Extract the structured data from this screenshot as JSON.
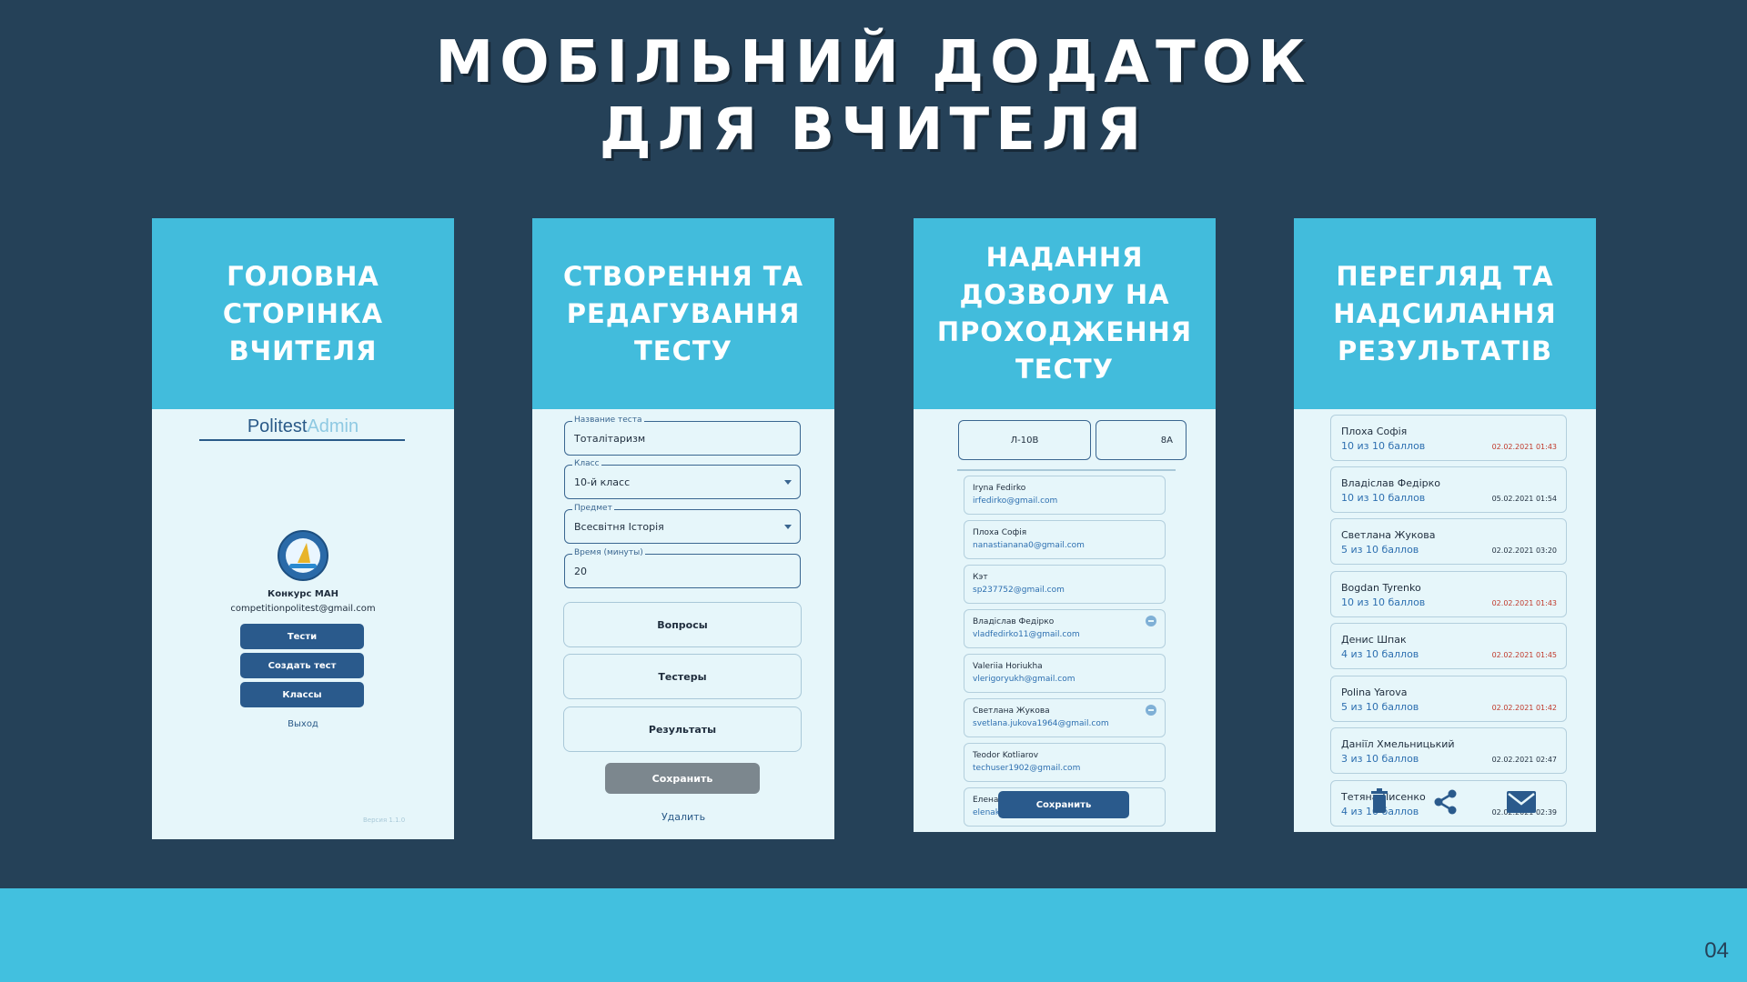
{
  "title": {
    "line1": "МОБІЛЬНИЙ ДОДАТОК",
    "line2": "ДЛЯ ВЧИТЕЛЯ"
  },
  "page_number": "04",
  "colors": {
    "background": "#254158",
    "accent": "#42bcdc",
    "button": "#2a5a8c",
    "screen": "#e6f6fa"
  },
  "cards": {
    "home": {
      "heading": [
        "ГОЛОВНА",
        "СТОРІНКА",
        "ВЧИТЕЛЯ"
      ],
      "logo_main": "Politest",
      "logo_admin": "Admin",
      "contest_name": "Конкурс МАН",
      "email": "competitionpolitest@gmail.com",
      "buttons": [
        "Тести",
        "Создать тест",
        "Классы"
      ],
      "exit": "Выход",
      "version": "Версия 1.1.0"
    },
    "edit": {
      "heading": [
        "СТВОРЕННЯ ТА",
        "РЕДАГУВАННЯ",
        "ТЕСТУ"
      ],
      "fields": [
        {
          "label": "Название теста",
          "value": "Тоталітаризм"
        },
        {
          "label": "Класс",
          "value": "10-й класс"
        },
        {
          "label": "Предмет",
          "value": "Всесвітня Історія"
        },
        {
          "label": "Время (минуты)",
          "value": "20"
        }
      ],
      "sections": [
        "Вопросы",
        "Тестеры",
        "Результаты"
      ],
      "save": "Сохранить",
      "delete": "Удалить"
    },
    "permission": {
      "heading": [
        "НАДАННЯ",
        "ДОЗВОЛУ НА",
        "ПРОХОДЖЕННЯ",
        "ТЕСТУ"
      ],
      "class_tabs": [
        "Л-10В",
        "8А"
      ],
      "testers": [
        {
          "name": "Iryna Fedirko",
          "email": "irfedirko@gmail.com"
        },
        {
          "name": "Плоха Софія",
          "email": "nanastianana0@gmail.com"
        },
        {
          "name": "Кэт",
          "email": "sp237752@gmail.com"
        },
        {
          "name": "Владіслав Федірко",
          "email": "vladfedirko11@gmail.com"
        },
        {
          "name": "Valeriia Horiukha",
          "email": "vlerigoryukh@gmail.com"
        },
        {
          "name": "Светлана Жукова",
          "email": "svetlana.jukova1964@gmail.com"
        },
        {
          "name": "Teodor Kotliarov",
          "email": "techuser1902@gmail.com"
        },
        {
          "name": "Елена",
          "email": "elenak"
        }
      ],
      "save": "Сохранить"
    },
    "results": {
      "heading": [
        "ПЕРЕГЛЯД ТА",
        "НАДСИЛАННЯ",
        "РЕЗУЛЬТАТІВ"
      ],
      "items": [
        {
          "name": "Плоха Софія",
          "score": "10 из 10 баллов",
          "date": "02.02.2021 01:43"
        },
        {
          "name": "Владіслав Федірко",
          "score": "10 из 10 баллов",
          "date": "05.02.2021 01:54"
        },
        {
          "name": "Светлана Жукова",
          "score": "5 из 10 баллов",
          "date": "02.02.2021 03:20"
        },
        {
          "name": "Bogdan Tyrenko",
          "score": "10 из 10 баллов",
          "date": "02.02.2021 01:43"
        },
        {
          "name": "Денис Шпак",
          "score": "4 из 10 баллов",
          "date": "02.02.2021 01:45"
        },
        {
          "name": "Polina Yarova",
          "score": "5 из 10 баллов",
          "date": "02.02.2021 01:42"
        },
        {
          "name": "Даніїл Хмельницький",
          "score": "3 из 10 баллов",
          "date": "02.02.2021 02:47"
        },
        {
          "name": "Тетяна Лисенко",
          "score": "4 из 10 баллов",
          "date": "02.02.2021 02:39"
        }
      ],
      "icons": [
        "trash-icon",
        "share-icon",
        "mail-icon"
      ]
    }
  }
}
